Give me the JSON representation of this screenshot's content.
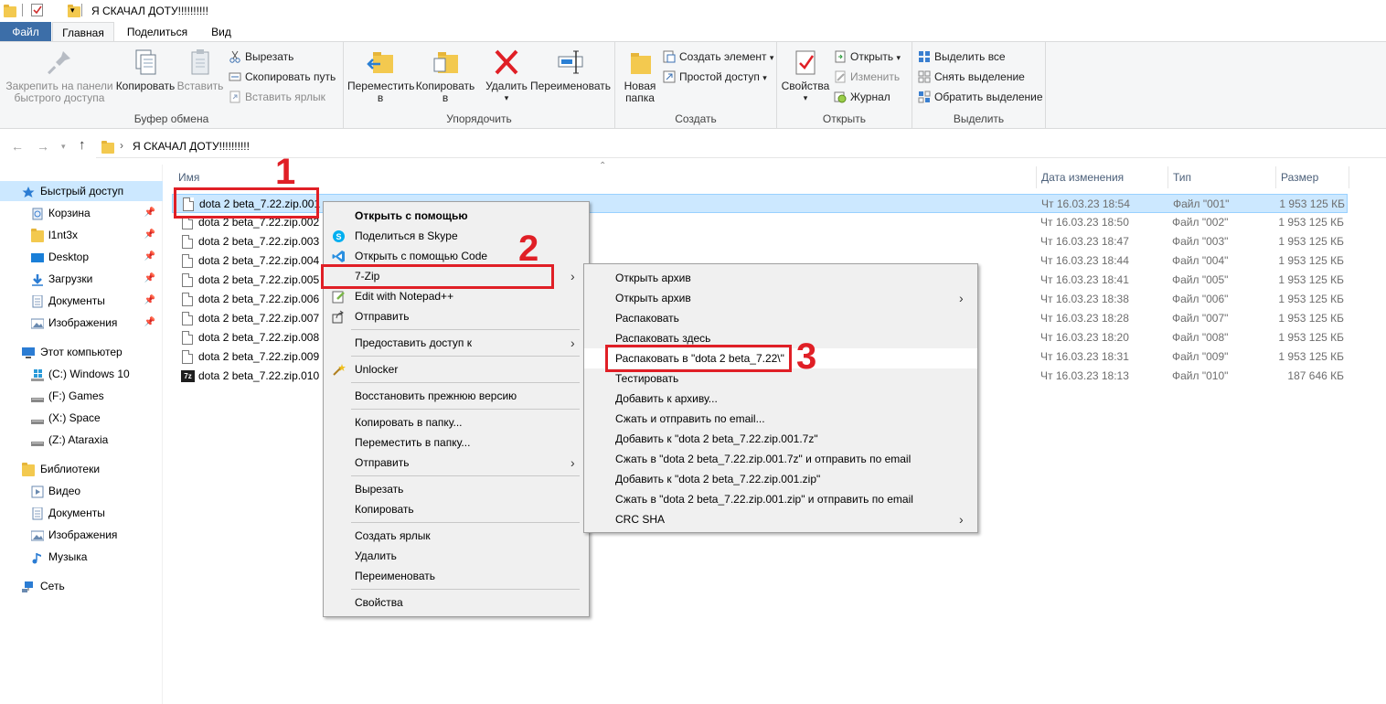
{
  "window": {
    "title": "Я СКАЧАЛ ДОТУ!!!!!!!!!!"
  },
  "tabs": [
    "Файл",
    "Главная",
    "Поделиться",
    "Вид"
  ],
  "ribbon": {
    "clipboard": {
      "label": "Буфер обмена",
      "pin": "Закрепить на панели быстрого доступа",
      "pin_line1": "Закрепить на панели",
      "pin_line2": "быстрого доступа",
      "copy": "Копировать",
      "paste": "Вставить",
      "cut": "Вырезать",
      "copy_path": "Скопировать путь",
      "paste_shortcut": "Вставить ярлык"
    },
    "organize": {
      "label": "Упорядочить",
      "move_to": "Переместить",
      "copy_to": "Копировать",
      "suffix": "в",
      "delete": "Удалить",
      "rename": "Переименовать"
    },
    "create": {
      "label": "Создать",
      "new_folder_line1": "Новая",
      "new_folder_line2": "папка",
      "new_item": "Создать элемент",
      "easy_access": "Простой доступ"
    },
    "open": {
      "label": "Открыть",
      "properties": "Свойства",
      "open": "Открыть",
      "edit": "Изменить",
      "history": "Журнал"
    },
    "select": {
      "label": "Выделить",
      "select_all": "Выделить все",
      "select_none": "Снять выделение",
      "invert": "Обратить выделение"
    }
  },
  "address": {
    "path": "Я СКАЧАЛ ДОТУ!!!!!!!!!!",
    "separator": "›"
  },
  "sidebar": {
    "quick_access": "Быстрый доступ",
    "quick_items": [
      "Корзина",
      "l1nt3x",
      "Desktop",
      "Загрузки",
      "Документы",
      "Изображения"
    ],
    "this_pc": "Этот компьютер",
    "drives": [
      "(C:) Windows 10",
      "(F:) Games",
      "(X:) Space",
      "(Z:) Ataraxia"
    ],
    "libraries": "Библиотеки",
    "lib_items": [
      "Видео",
      "Документы",
      "Изображения",
      "Музыка"
    ],
    "network": "Сеть"
  },
  "columns": {
    "name": "Имя",
    "date": "Дата изменения",
    "type": "Тип",
    "size": "Размер"
  },
  "files": [
    {
      "name": "dota 2 beta_7.22.zip.001",
      "date": "Чт 16.03.23 18:54",
      "type": "Файл \"001\"",
      "size": "1 953 125 КБ"
    },
    {
      "name": "dota 2 beta_7.22.zip.002",
      "date": "Чт 16.03.23 18:50",
      "type": "Файл \"002\"",
      "size": "1 953 125 КБ"
    },
    {
      "name": "dota 2 beta_7.22.zip.003",
      "date": "Чт 16.03.23 18:47",
      "type": "Файл \"003\"",
      "size": "1 953 125 КБ"
    },
    {
      "name": "dota 2 beta_7.22.zip.004",
      "date": "Чт 16.03.23 18:44",
      "type": "Файл \"004\"",
      "size": "1 953 125 КБ"
    },
    {
      "name": "dota 2 beta_7.22.zip.005",
      "date": "Чт 16.03.23 18:41",
      "type": "Файл \"005\"",
      "size": "1 953 125 КБ"
    },
    {
      "name": "dota 2 beta_7.22.zip.006",
      "date": "Чт 16.03.23 18:38",
      "type": "Файл \"006\"",
      "size": "1 953 125 КБ"
    },
    {
      "name": "dota 2 beta_7.22.zip.007",
      "date": "Чт 16.03.23 18:28",
      "type": "Файл \"007\"",
      "size": "1 953 125 КБ"
    },
    {
      "name": "dota 2 beta_7.22.zip.008",
      "date": "Чт 16.03.23 18:20",
      "type": "Файл \"008\"",
      "size": "1 953 125 КБ"
    },
    {
      "name": "dota 2 beta_7.22.zip.009",
      "date": "Чт 16.03.23 18:31",
      "type": "Файл \"009\"",
      "size": "1 953 125 КБ"
    },
    {
      "name": "dota 2 beta_7.22.zip.010",
      "date": "Чт 16.03.23 18:13",
      "type": "Файл \"010\"",
      "size": "187 646 КБ"
    }
  ],
  "context_menu": {
    "open_with": "Открыть с помощью",
    "share_skype": "Поделиться в Skype",
    "open_code": "Открыть с помощью Code",
    "seven_zip": "7-Zip",
    "notepad": "Edit with Notepad++",
    "send": "Отправить",
    "grant_access": "Предоставить доступ к",
    "unlocker": "Unlocker",
    "restore": "Восстановить прежнюю версию",
    "copy_to_folder": "Копировать в папку...",
    "move_to_folder": "Переместить в папку...",
    "send_to": "Отправить",
    "cut": "Вырезать",
    "copy": "Копировать",
    "create_shortcut": "Создать ярлык",
    "delete": "Удалить",
    "rename": "Переименовать",
    "properties": "Свойства"
  },
  "submenu": {
    "items": [
      "Открыть архив",
      "Открыть архив",
      "Распаковать",
      "Распаковать здесь",
      "Распаковать в \"dota 2 beta_7.22\\\"",
      "Тестировать",
      "Добавить к архиву...",
      "Сжать и отправить по email...",
      "Добавить к \"dota 2 beta_7.22.zip.001.7z\"",
      "Сжать в \"dota 2 beta_7.22.zip.001.7z\" и отправить по email",
      "Добавить к \"dota 2 beta_7.22.zip.001.zip\"",
      "Сжать в \"dota 2 beta_7.22.zip.001.zip\" и отправить по email",
      "CRC SHA"
    ]
  },
  "annotations": {
    "step1": "1",
    "step2": "2",
    "step3": "3"
  },
  "colors": {
    "accent_red": "#e01f26",
    "selection": "#cce8ff",
    "file_tab": "#3c6ea8"
  }
}
